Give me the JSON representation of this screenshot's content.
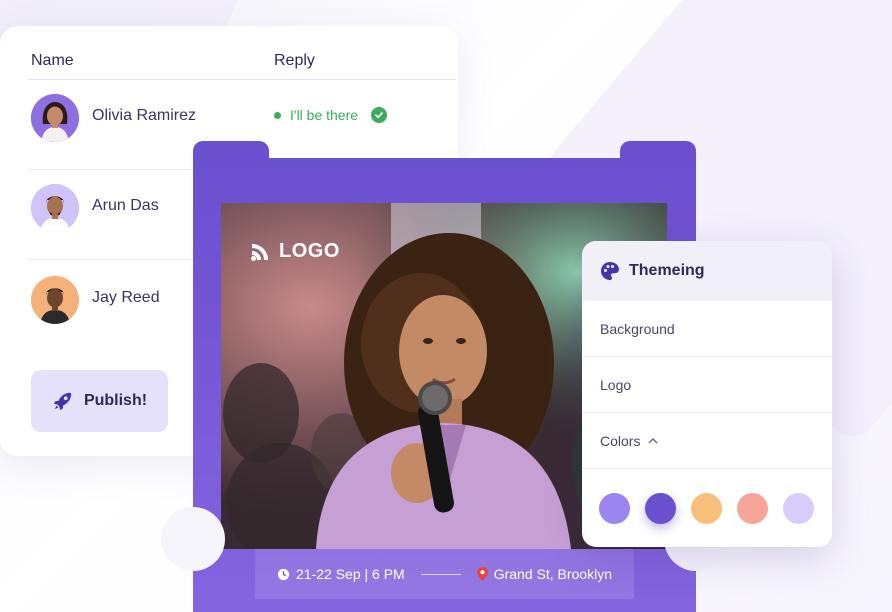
{
  "guest_list": {
    "headers": {
      "name": "Name",
      "reply": "Reply"
    },
    "guests": [
      {
        "name": "Olivia Ramirez",
        "reply": "I'll be there",
        "avatar_icon": "person-avatar-woman"
      },
      {
        "name": "Arun Das",
        "reply": "",
        "avatar_icon": "person-avatar-man"
      },
      {
        "name": "Jay Reed",
        "reply": "",
        "avatar_icon": "person-avatar-man"
      }
    ],
    "publish_label": "Publish!",
    "publish_icon": "rocket-icon"
  },
  "event_ticket": {
    "logo_text": "LOGO",
    "logo_icon": "rss-icon",
    "datetime": "21-22 Sep | 6 PM",
    "location": "Grand St, Brooklyn",
    "datetime_icon": "clock-icon",
    "location_icon": "pin-icon"
  },
  "theming": {
    "title": "Themeing",
    "title_icon": "palette-icon",
    "items": [
      "Background",
      "Logo",
      "Colors"
    ],
    "colors_expanded": true,
    "swatches": [
      "#9a86ee",
      "#6a4fcf",
      "#f8c07a",
      "#f6a598",
      "#d7ccfb"
    ],
    "selected_swatch": 1
  },
  "colors": {
    "accent": "#6a4fcf",
    "success": "#3eaa5c",
    "text_dark": "#2f2a55"
  }
}
